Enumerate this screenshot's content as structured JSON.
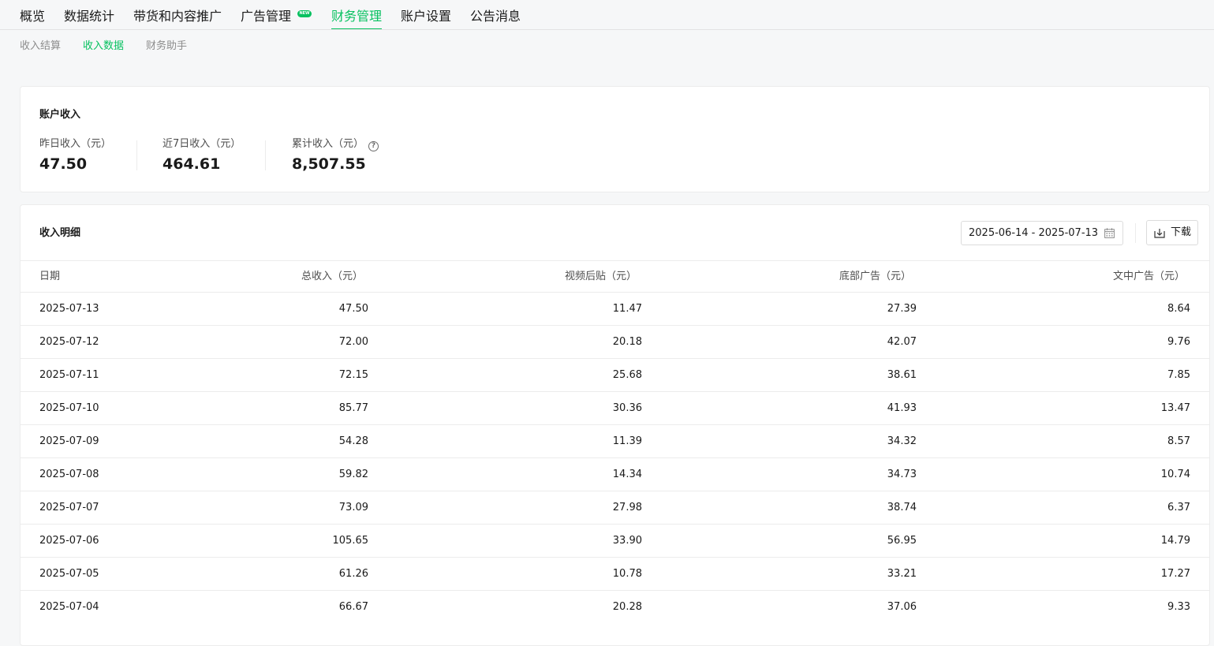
{
  "nav": {
    "items": [
      "概览",
      "数据统计",
      "带货和内容推广",
      "广告管理",
      "财务管理",
      "账户设置",
      "公告消息"
    ],
    "badge": "NEW",
    "active_index": 4
  },
  "sub_nav": {
    "items": [
      "收入结算",
      "收入数据",
      "财务助手"
    ],
    "active_index": 1
  },
  "income": {
    "title": "账户收入",
    "stats": [
      {
        "label": "昨日收入（元）",
        "value": "47.50"
      },
      {
        "label": "近7日收入（元）",
        "value": "464.61"
      },
      {
        "label": "累计收入（元）",
        "value": "8,507.55"
      }
    ]
  },
  "detail": {
    "title": "收入明细",
    "date_range": "2025-06-14 - 2025-07-13",
    "download_label": "下载",
    "columns": [
      "日期",
      "总收入（元）",
      "视频后贴（元）",
      "底部广告（元）",
      "文中广告（元）"
    ],
    "rows": [
      [
        "2025-07-13",
        "47.50",
        "11.47",
        "27.39",
        "8.64"
      ],
      [
        "2025-07-12",
        "72.00",
        "20.18",
        "42.07",
        "9.76"
      ],
      [
        "2025-07-11",
        "72.15",
        "25.68",
        "38.61",
        "7.85"
      ],
      [
        "2025-07-10",
        "85.77",
        "30.36",
        "41.93",
        "13.47"
      ],
      [
        "2025-07-09",
        "54.28",
        "11.39",
        "34.32",
        "8.57"
      ],
      [
        "2025-07-08",
        "59.82",
        "14.34",
        "34.73",
        "10.74"
      ],
      [
        "2025-07-07",
        "73.09",
        "27.98",
        "38.74",
        "6.37"
      ],
      [
        "2025-07-06",
        "105.65",
        "33.90",
        "56.95",
        "14.79"
      ],
      [
        "2025-07-05",
        "61.26",
        "10.78",
        "33.21",
        "17.27"
      ],
      [
        "2025-07-04",
        "66.67",
        "20.28",
        "37.06",
        "9.33"
      ]
    ]
  },
  "colors": {
    "accent": "#07c160"
  }
}
